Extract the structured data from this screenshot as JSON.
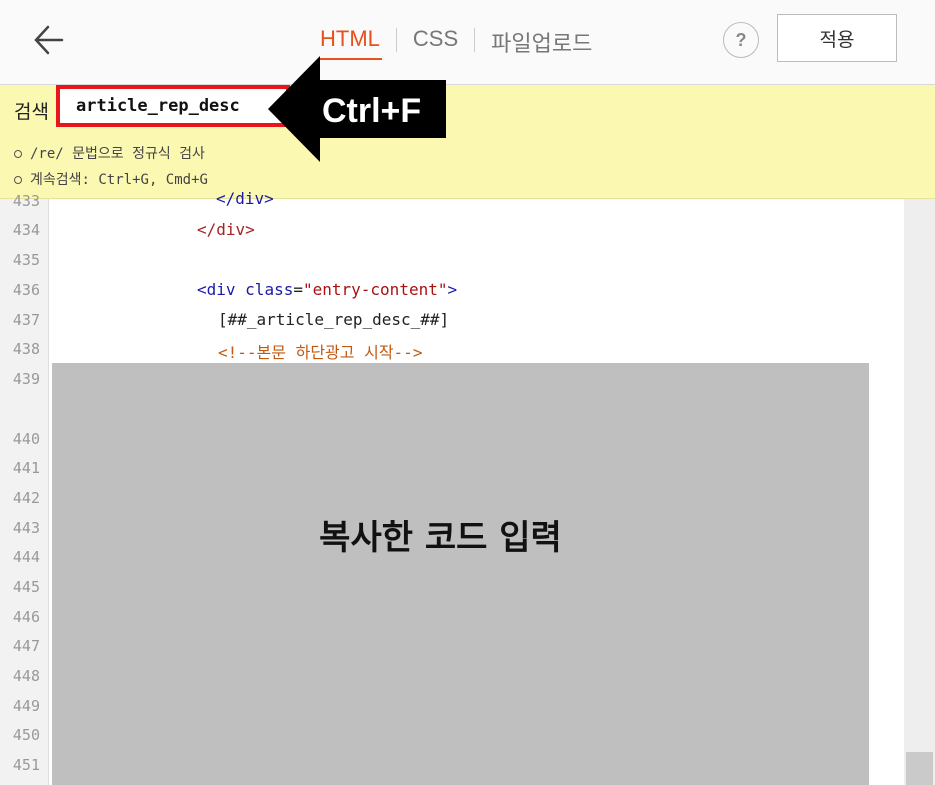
{
  "header": {
    "tabs": [
      {
        "label": "HTML",
        "active": true
      },
      {
        "label": "CSS",
        "active": false
      },
      {
        "label": "파일업로드",
        "active": false
      }
    ],
    "help_label": "?",
    "apply_label": "적용",
    "back_icon": "arrow-left-icon"
  },
  "search": {
    "label": "검색",
    "value": "article_rep_desc",
    "hints": [
      "/re/ 문법으로 정규식 검사",
      "계속검색: Ctrl+G, Cmd+G"
    ]
  },
  "callout": {
    "text": "Ctrl+F"
  },
  "editor": {
    "line_numbers": [
      "433",
      "434",
      "435",
      "436",
      "437",
      "438",
      "439",
      "440",
      "441",
      "442",
      "443",
      "444",
      "445",
      "446",
      "447",
      "448",
      "449",
      "450",
      "451"
    ],
    "lines": {
      "l433": "</div>",
      "l434": "</div>",
      "l436_open": "<div ",
      "l436_attr": "class",
      "l436_eq": "=",
      "l436_val": "\"entry-content\"",
      "l436_close": ">",
      "l437": "[##_article_rep_desc_##]",
      "l438": "<!--본문 하단광고 시작-->"
    },
    "overlay_text": "복사한 코드 입력"
  },
  "colors": {
    "accent": "#e8501e",
    "search_bg": "#fbf8b2",
    "search_border": "#e8161b",
    "overlay": "#bfbfbf"
  }
}
